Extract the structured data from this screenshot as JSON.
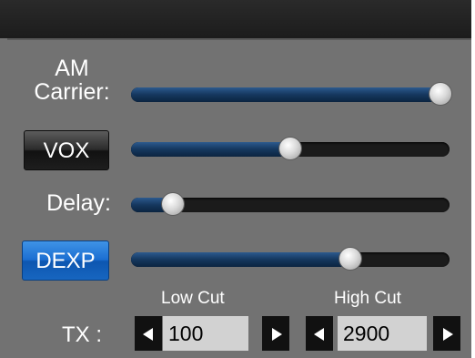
{
  "colors": {
    "panel_bg": "#727272",
    "titlebar_bg": "#1f1f1f",
    "slider_fill": "#1e4a7a",
    "slider_track": "#1b1b1b",
    "dexp_active": "#1b6ed1"
  },
  "rows": {
    "am_carrier": {
      "label_line1": "AM",
      "label_line2": "Carrier:",
      "level": 0.97
    },
    "vox": {
      "button_label": "VOX",
      "active": false,
      "level": 0.5
    },
    "delay": {
      "label": "Delay:",
      "level": 0.13
    },
    "dexp": {
      "button_label": "DEXP",
      "active": true,
      "level": 0.69
    }
  },
  "tx": {
    "label": "TX :",
    "low_cut": {
      "label": "Low Cut",
      "value": "100"
    },
    "high_cut": {
      "label": "High Cut",
      "value": "2900"
    },
    "icons": {
      "decrement": "left-triangle-icon",
      "increment": "right-triangle-icon"
    }
  }
}
